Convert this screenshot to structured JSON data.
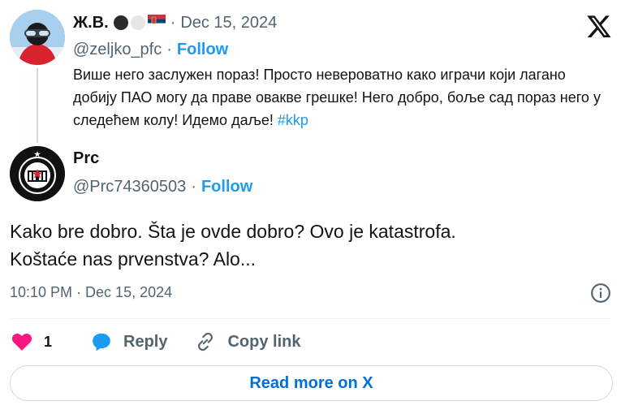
{
  "quoted": {
    "display_name": "Ж.В.",
    "handle": "@zeljko_pfc",
    "follow_label": "Follow",
    "date": "Dec 15, 2024",
    "dot_separator": "·",
    "text": "Више него заслужен пораз! Просто невероватно како играчи који лагано добију ПАО могу да праве овакве грешке! Него добро, боље сад пораз него у следећем колу! Идемо даље!",
    "hashtag": "#kkp"
  },
  "reply": {
    "display_name": "Prc",
    "handle": "@Prc74360503",
    "follow_label": "Follow",
    "dot_separator": "·",
    "text_line1": "Kako bre dobro. Šta je ovde dobro? Ovo je katastrofa.",
    "text_line2": "Koštaće nas prvenstva? Alo...",
    "timestamp": "10:10 PM · Dec 15, 2024"
  },
  "actions": {
    "like_count": "1",
    "reply_label": "Reply",
    "copy_link_label": "Copy link"
  },
  "footer": {
    "read_more_label": "Read more on X"
  },
  "colors": {
    "accent": "#1d9bf0",
    "like": "#f91880",
    "muted": "#536471"
  }
}
